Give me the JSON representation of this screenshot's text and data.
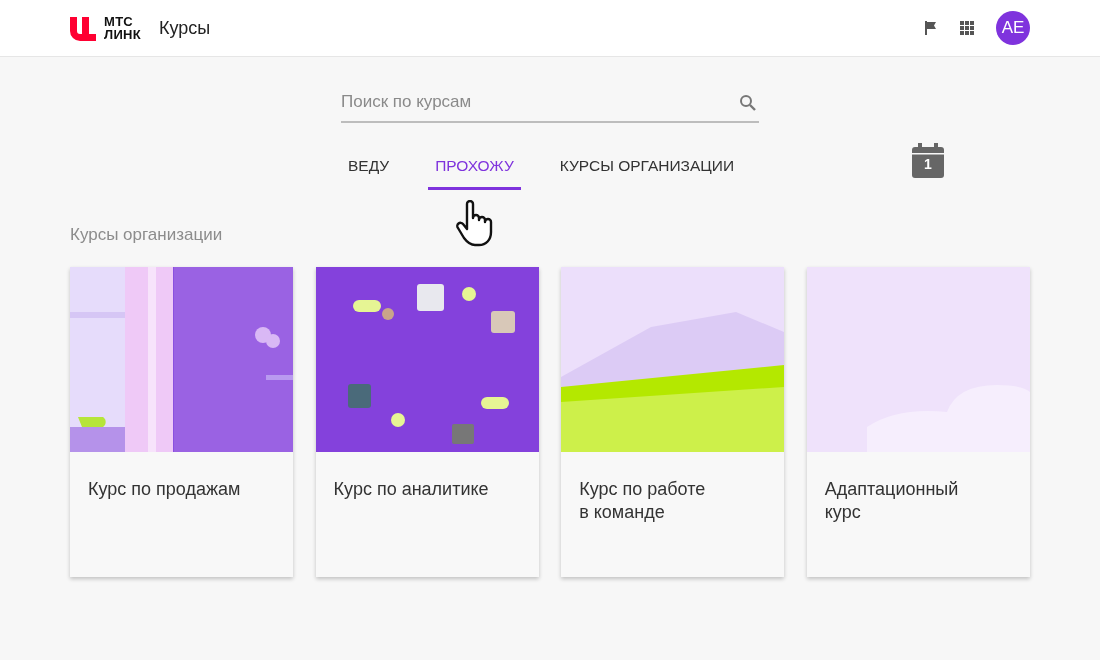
{
  "header": {
    "logo_lines": [
      "МТС",
      "ЛИНК"
    ],
    "title": "Курсы",
    "avatar": "AE"
  },
  "search": {
    "placeholder": "Поиск по курсам"
  },
  "tabs": [
    {
      "label": "ВЕДУ",
      "selected": false
    },
    {
      "label": "ПРОХОЖУ",
      "selected": true
    },
    {
      "label": "КУРСЫ ОРГАНИЗАЦИИ",
      "selected": false
    }
  ],
  "calendar": {
    "day": "1"
  },
  "section_title": "Курсы организации",
  "courses": [
    {
      "kind": "window",
      "title": "Курс по продажам"
    },
    {
      "kind": "avatars",
      "title": "Курс по аналитике"
    },
    {
      "kind": "field",
      "title": "Курс по работе\nв команде"
    },
    {
      "kind": "clouds",
      "title": "Адаптационный\nкурс"
    }
  ]
}
